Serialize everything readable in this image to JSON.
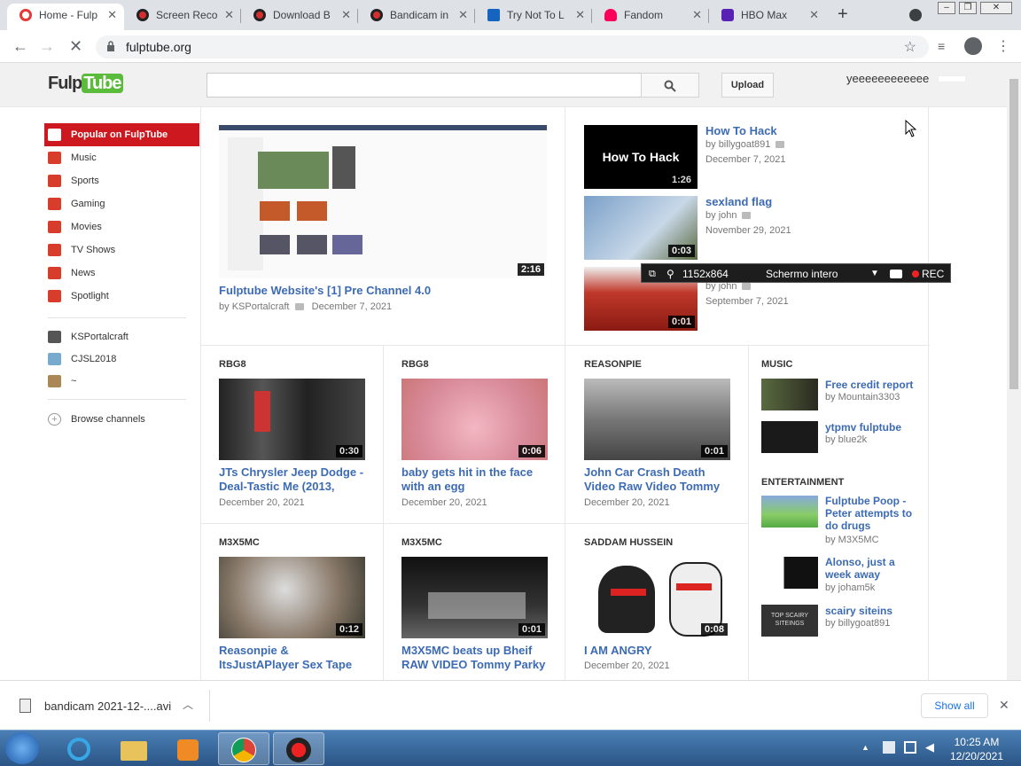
{
  "browser": {
    "tabs": [
      {
        "label": "Home - Fulp",
        "active": true,
        "icon": "chrome-icon",
        "color": "#e53935"
      },
      {
        "label": "Screen Reco",
        "active": false,
        "icon": "bandicam-icon",
        "color": "#d32f2f"
      },
      {
        "label": "Download B",
        "active": false,
        "icon": "bandicam-icon",
        "color": "#d32f2f"
      },
      {
        "label": "Bandicam in",
        "active": false,
        "icon": "bandicam-icon",
        "color": "#d32f2f"
      },
      {
        "label": "Try Not To L",
        "active": false,
        "icon": "tvtropes-icon",
        "color": "#1565c0"
      },
      {
        "label": "Fandom",
        "active": false,
        "icon": "fandom-icon",
        "color": "#fa005a"
      },
      {
        "label": "HBO Max",
        "active": false,
        "icon": "hbomax-icon",
        "color": "#5822b4"
      }
    ],
    "new_tab": "+",
    "url": "fulptube.org"
  },
  "site": {
    "logo_a": "Fulp",
    "logo_b": "Tube",
    "upload_label": "Upload",
    "username": "yeeeeeeeeeeee"
  },
  "sidebar": {
    "items": [
      {
        "label": "Popular on FulpTube",
        "selected": true,
        "color": "#cc181e"
      },
      {
        "label": "Music",
        "selected": false,
        "color": "#d83d2c"
      },
      {
        "label": "Sports",
        "selected": false,
        "color": "#d83d2c"
      },
      {
        "label": "Gaming",
        "selected": false,
        "color": "#d83d2c"
      },
      {
        "label": "Movies",
        "selected": false,
        "color": "#d83d2c"
      },
      {
        "label": "TV Shows",
        "selected": false,
        "color": "#d83d2c"
      },
      {
        "label": "News",
        "selected": false,
        "color": "#d83d2c"
      },
      {
        "label": "Spotlight",
        "selected": false,
        "color": "#d83d2c"
      }
    ],
    "subscriptions": [
      {
        "label": "KSPortalcraft",
        "color": "#555"
      },
      {
        "label": "CJSL2018",
        "color": "#7ac"
      },
      {
        "label": "~",
        "color": "#a85"
      }
    ],
    "browse_label": "Browse channels"
  },
  "featured": {
    "title": "Fulptube Website's [1] Pre Channel 4.0",
    "channel": "KSPortalcraft",
    "date": "December 7, 2021",
    "duration": "2:16"
  },
  "side_videos": [
    {
      "title": "How To Hack",
      "channel": "billygoat891",
      "date": "December 7, 2021",
      "duration": "1:26",
      "thumb_text": "How To Hack"
    },
    {
      "title": "sexland flag",
      "channel": "john",
      "date": "November 29, 2021",
      "duration": "0:03"
    },
    {
      "title": "",
      "channel": "john",
      "date": "September 7, 2021",
      "duration": "0:01"
    }
  ],
  "grid": [
    {
      "channel": "RBG8",
      "title_lines": [
        "JTs Chrysler Jeep Dodge -",
        "Deal-Tastic Me (2013,"
      ],
      "date": "December 20, 2021",
      "duration": "0:30"
    },
    {
      "channel": "RBG8",
      "title_lines": [
        "baby gets hit in the face",
        "with an egg"
      ],
      "date": "December 20, 2021",
      "duration": "0:06"
    },
    {
      "channel": "REASONPIE",
      "title_lines": [
        "John Car Crash Death",
        "Video Raw Video Tommy"
      ],
      "date": "December 20, 2021",
      "duration": "0:01"
    },
    {
      "channel": "M3X5MC",
      "title_lines": [
        "Reasonpie &",
        "ItsJustAPlayer Sex Tape"
      ],
      "date": "",
      "duration": "0:12"
    },
    {
      "channel": "M3X5MC",
      "title_lines": [
        "M3X5MC beats up Bheif",
        "RAW VIDEO Tommy Parky"
      ],
      "date": "",
      "duration": "0:01"
    },
    {
      "channel": "SADDAM HUSSEIN",
      "title_lines": [
        "I AM ANGRY",
        ""
      ],
      "date": "December 20, 2021",
      "duration": "0:08"
    }
  ],
  "music": {
    "heading": "MUSIC",
    "items": [
      {
        "title_lines": [
          "Free credit report"
        ],
        "channel": "by Mountain3303"
      },
      {
        "title_lines": [
          "ytpmv fulptube"
        ],
        "channel": "by blue2k"
      }
    ]
  },
  "entertainment": {
    "heading": "ENTERTAINMENT",
    "items": [
      {
        "title_lines": [
          "Fulptube Poop -",
          "Peter attempts to",
          "do drugs"
        ],
        "channel": "by M3X5MC"
      },
      {
        "title_lines": [
          "Alonso, just a",
          "week away"
        ],
        "channel": "by joham5k"
      },
      {
        "title_lines": [
          "scairy siteins"
        ],
        "channel": "by billygoat891",
        "thumb_text": "TOP SCAIRY SITEINGS"
      }
    ]
  },
  "recorder": {
    "size": "1152x864",
    "mode": "Schermo intero",
    "rec": "REC"
  },
  "download": {
    "file": "bandicam 2021-12-....avi",
    "show_all": "Show all"
  },
  "taskbar": {
    "time": "10:25 AM",
    "date": "12/20/2021"
  },
  "by_prefix": "by"
}
